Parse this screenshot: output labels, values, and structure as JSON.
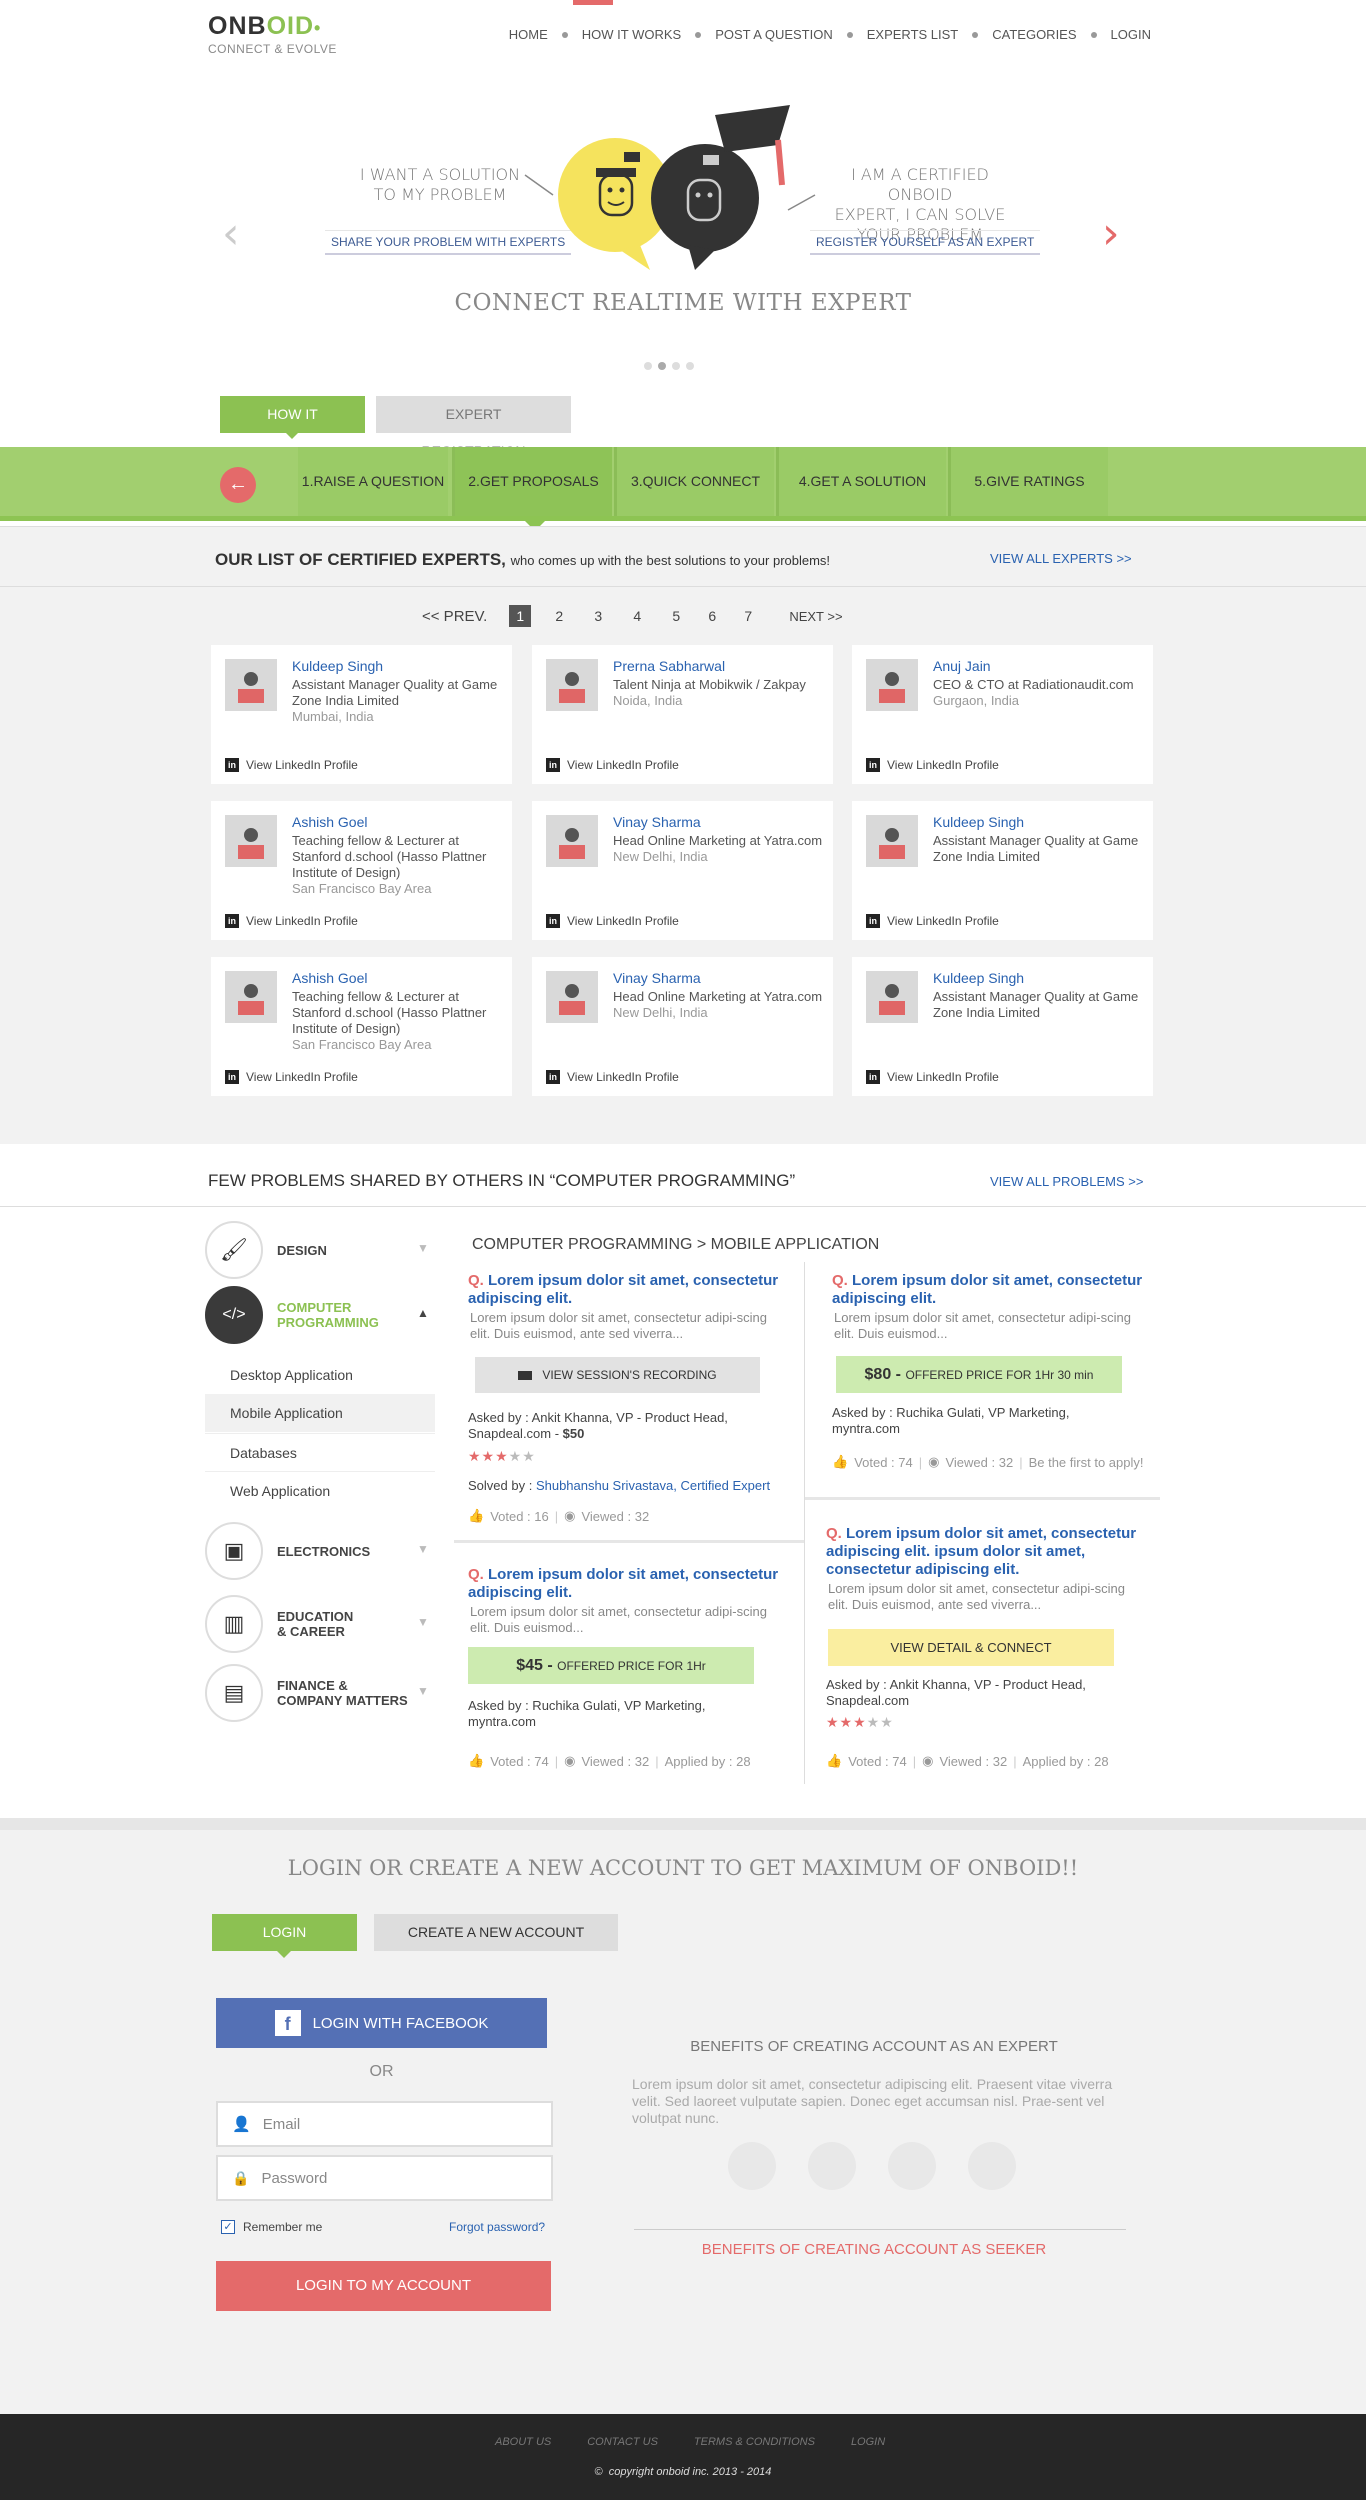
{
  "brand": {
    "name_a": "ONB",
    "name_b": "OID",
    "tagline": "CONNECT & EVOLVE"
  },
  "nav": [
    "HOME",
    "HOW IT WORKS",
    "POST A QUESTION",
    "EXPERTS LIST",
    "CATEGORIES",
    "LOGIN"
  ],
  "hero": {
    "left_text_1": "I WANT A SOLUTION",
    "left_text_2": "TO MY PROBLEM",
    "left_link": "SHARE YOUR PROBLEM WITH EXPERTS",
    "right_text_1": "I AM A CERTIFIED ONBOID",
    "right_text_2": "EXPERT, I CAN SOLVE",
    "right_text_3": "YOUR PROBLEM",
    "right_link": "REGISTER YOURSELF AS AN EXPERT",
    "title": "CONNECT REALTIME  WITH EXPERT",
    "prev": "‹",
    "next": "›"
  },
  "how": {
    "tab_active": "HOW IT WORKS",
    "tab_other": "EXPERT REGISTRATION",
    "steps": [
      "1.RAISE A QUESTION",
      "2.GET PROPOSALS",
      "3.QUICK CONNECT",
      "4.GET A SOLUTION",
      "5.GIVE RATINGS"
    ]
  },
  "experts": {
    "heading": "OUR LIST OF CERTIFIED EXPERTS,",
    "subheading": "who comes up with the best solutions to your problems!",
    "view_all": "VIEW ALL EXPERTS >>",
    "pager": {
      "prev": "<< PREV.",
      "pages": [
        "1",
        "2",
        "3",
        "4",
        "5",
        "6",
        "7"
      ],
      "next": "NEXT >>"
    },
    "linkedin_label": "View LinkedIn Profile",
    "cards": [
      {
        "name": "Kuldeep Singh",
        "role": "Assistant Manager Quality at Game Zone India Limited",
        "loc": "Mumbai, India"
      },
      {
        "name": "Prerna Sabharwal",
        "role": "Talent Ninja at Mobikwik / Zakpay",
        "loc": "Noida, India"
      },
      {
        "name": "Anuj Jain",
        "role": "CEO & CTO at Radiationaudit.com",
        "loc": "Gurgaon, India"
      },
      {
        "name": "Ashish Goel",
        "role": "Teaching fellow & Lecturer at Stanford d.school (Hasso Plattner Institute of Design)",
        "loc": "San Francisco Bay Area"
      },
      {
        "name": "Vinay Sharma",
        "role": "Head Online Marketing at Yatra.com",
        "loc": "New Delhi, India"
      },
      {
        "name": "Kuldeep Singh",
        "role": "Assistant Manager Quality at Game Zone India Limited",
        "loc": ""
      },
      {
        "name": "Ashish Goel",
        "role": "Teaching fellow & Lecturer at Stanford d.school (Hasso Plattner Institute of Design)",
        "loc": "San Francisco Bay Area"
      },
      {
        "name": "Vinay Sharma",
        "role": "Head Online Marketing at Yatra.com",
        "loc": "New Delhi, India"
      },
      {
        "name": "Kuldeep Singh",
        "role": "Assistant Manager Quality at Game Zone India Limited",
        "loc": ""
      }
    ]
  },
  "problems": {
    "heading": "FEW PROBLEMS SHARED  BY OTHERS IN “COMPUTER PROGRAMMING”",
    "view_all": "VIEW ALL PROBLEMS >>",
    "breadcrumb": "COMPUTER PROGRAMMING > MOBILE APPLICATION",
    "categories": {
      "design": "DESIGN",
      "cp_1": "COMPUTER",
      "cp_2": "PROGRAMMING",
      "electronics": "ELECTRONICS",
      "edu_1": "EDUCATION",
      "edu_2": "& CAREER",
      "fin_1": "FINANCE &",
      "fin_2": "COMPANY MATTERS"
    },
    "subcategories": [
      "Desktop Application",
      "Mobile Application",
      "Databases",
      "Web Application"
    ],
    "q": "Q.",
    "p1": {
      "title": "Lorem ipsum dolor sit amet, consectetur adipiscing elit.",
      "desc": "Lorem ipsum dolor sit amet, consectetur adipi-scing elit. Duis euismod, ante sed viverra...",
      "button": "VIEW SESSION'S RECORDING",
      "asked": "Asked by : Ankit Khanna, VP - Product Head, Snapdeal.com  -  ",
      "amount": "$50",
      "solved_label": "Solved by : ",
      "solved_name": "Shubhanshu Srivastava, Certified Expert",
      "voted": "Voted : 16",
      "viewed": "Viewed : 32"
    },
    "p2": {
      "title": "Lorem ipsum dolor sit amet, consectetur adipiscing elit.",
      "desc": "Lorem ipsum dolor sit amet, consectetur adipi-scing elit. Duis euismod...",
      "price": "$80 - ",
      "price_note": "OFFERED PRICE FOR 1Hr 30 min",
      "asked": "Asked by : Ruchika Gulati, VP Marketing, myntra.com",
      "voted": "Voted : 74",
      "viewed": "Viewed : 32",
      "extra": "Be the first to apply!"
    },
    "p3": {
      "title": "Lorem ipsum dolor sit amet, consectetur adipiscing elit.",
      "desc": "Lorem ipsum dolor sit amet, consectetur adipi-scing elit. Duis euismod...",
      "price": "$45 - ",
      "price_note": "OFFERED PRICE FOR 1Hr",
      "asked": "Asked by : Ruchika Gulati, VP Marketing, myntra.com",
      "voted": "Voted : 74",
      "viewed": "Viewed : 32",
      "applied": "Applied by : 28"
    },
    "p4": {
      "title": "Lorem ipsum dolor sit amet, consectetur adipiscing elit. ipsum dolor sit amet, consectetur adipiscing elit.",
      "desc": "Lorem ipsum dolor sit amet, consectetur adipi-scing elit. Duis euismod, ante sed viverra...",
      "button": "VIEW DETAIL & CONNECT",
      "asked": "Asked by : Ankit Khanna, VP - Product Head, Snapdeal.com",
      "voted": "Voted : 74",
      "viewed": "Viewed : 32",
      "applied": "Applied by : 28"
    }
  },
  "login": {
    "heading": "LOGIN OR CREATE A NEW ACCOUNT TO GET MAXIMUM OF ONBOID!!",
    "tab_login": "LOGIN",
    "tab_create": "CREATE A NEW ACCOUNT",
    "facebook": "LOGIN WITH FACEBOOK",
    "or": "OR",
    "email_placeholder": "Email",
    "password_placeholder": "Password",
    "remember": "Remember me",
    "forgot": "Forgot password?",
    "submit": "LOGIN TO MY ACCOUNT",
    "benefits_expert": "BENEFITS OF CREATING ACCOUNT AS AN EXPERT",
    "benefits_text": "Lorem ipsum dolor sit amet, consectetur adipiscing elit. Praesent vitae viverra velit. Sed laoreet vulputate sapien. Donec eget accumsan nisl. Prae-sent vel volutpat nunc.",
    "benefits_seeker": "BENEFITS OF CREATING ACCOUNT AS SEEKER"
  },
  "footer": {
    "links": [
      "ABOUT US",
      "CONTACT US",
      "TERMS & CONDITIONS",
      "LOGIN"
    ],
    "copyright": "copyright onboid inc. 2013 - 2014",
    "copy_symbol": "©"
  },
  "colors": {
    "green": "#8cc152",
    "red": "#e46a6a",
    "blue": "#2a62b0",
    "facebook": "#5470b5",
    "footer": "#262626"
  }
}
